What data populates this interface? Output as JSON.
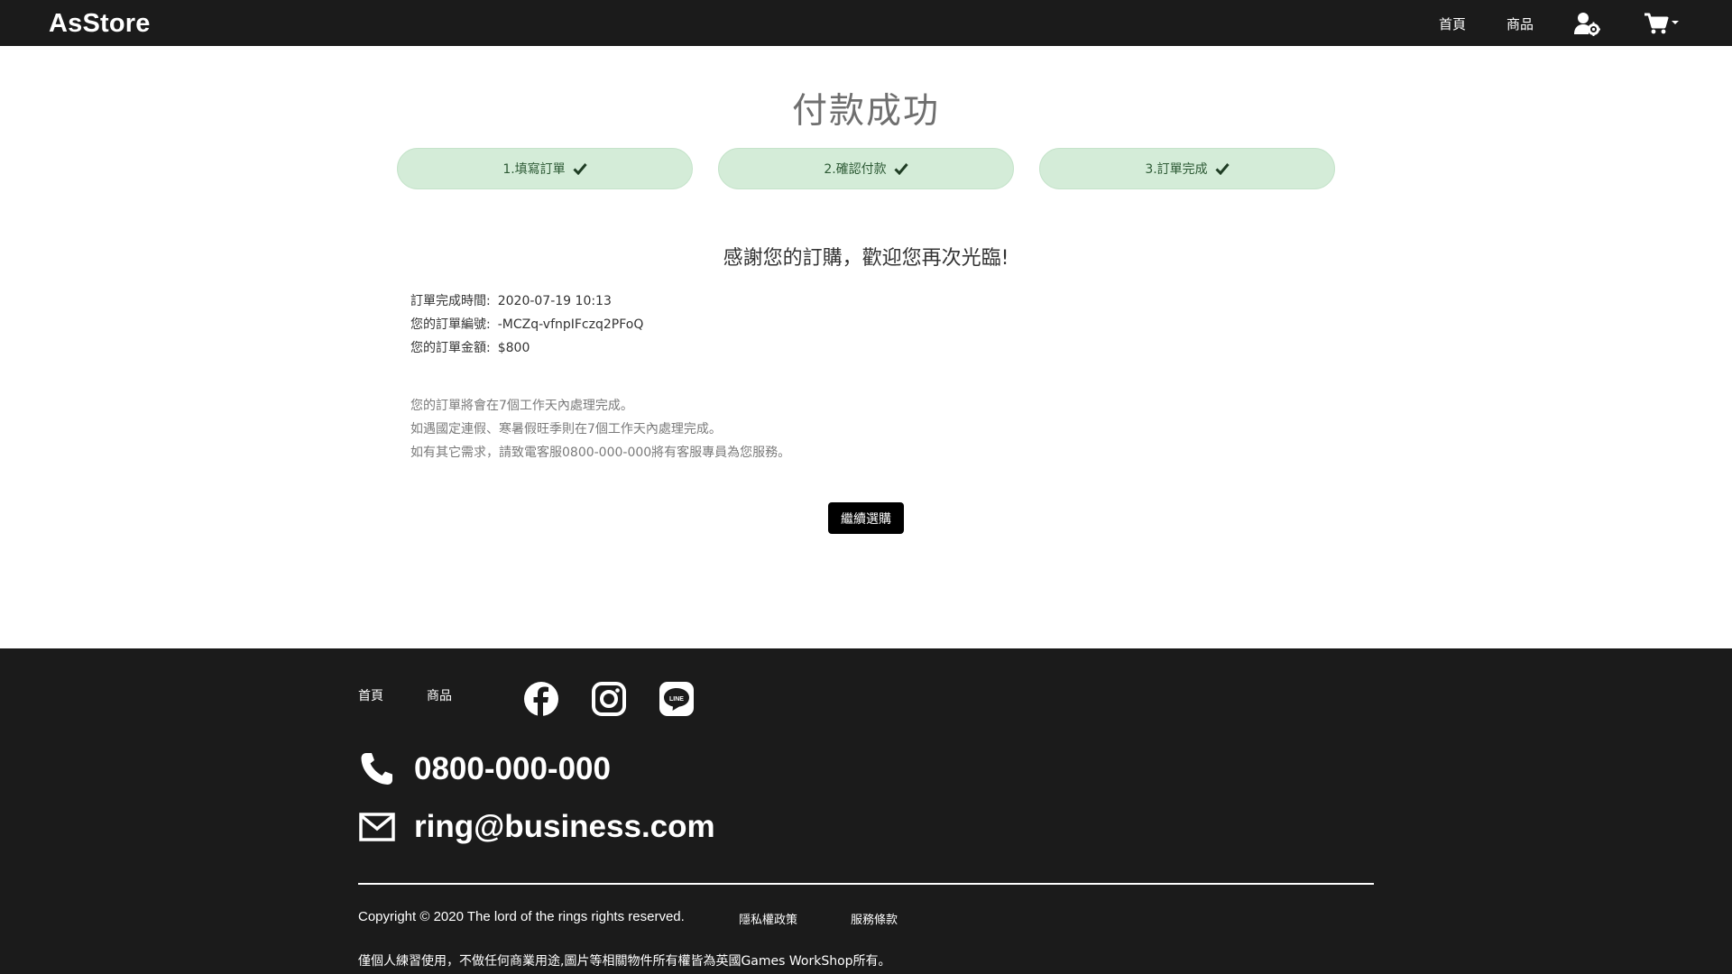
{
  "navbar": {
    "brand": "AsStore",
    "links": [
      {
        "label": "首頁"
      },
      {
        "label": "商品"
      }
    ],
    "icons": [
      "user-gear-icon",
      "shopping-cart-icon"
    ]
  },
  "main": {
    "title": "付款成功",
    "steps": [
      {
        "label": "1.填寫訂單",
        "done": true
      },
      {
        "label": "2.確認付款",
        "done": true
      },
      {
        "label": "3.訂單完成",
        "done": true
      }
    ],
    "thanks": "感謝您的訂購，歡迎您再次光臨!",
    "order_info": [
      {
        "label": "訂單完成時間:",
        "value": "2020-07-19 10:13"
      },
      {
        "label": "您的訂單編號:",
        "value": "-MCZq-vfnpIFczq2PFoQ"
      },
      {
        "label": "您的訂單金額:",
        "value": "$800"
      }
    ],
    "notes": [
      "您的訂單將會在7個工作天內處理完成。",
      "如遇國定連假、寒暑假旺季則在7個工作天內處理完成。",
      "如有其它需求，請致電客服0800-000-000將有客服專員為您服務。"
    ],
    "continue_label": "繼續選購"
  },
  "footer": {
    "links": [
      {
        "label": "首頁"
      },
      {
        "label": "商品"
      }
    ],
    "social": [
      "facebook-icon",
      "instagram-icon",
      "line-icon"
    ],
    "phone": "0800-000-000",
    "email": "ring@business.com",
    "copyright": "Copyright © 2020 The lord of the rings rights reserved.",
    "privacy": "隱私權政策",
    "terms": "服務條款",
    "disclaimer": "僅個人練習使用，不做任何商業用途,圖片等相關物件所有權皆為英國Games WorkShop所有。"
  },
  "colors": {
    "navbar_bg": "#1b1b1b",
    "step_bg": "#d4ecd8",
    "step_text": "#2d5a35",
    "button_bg": "#000000"
  }
}
